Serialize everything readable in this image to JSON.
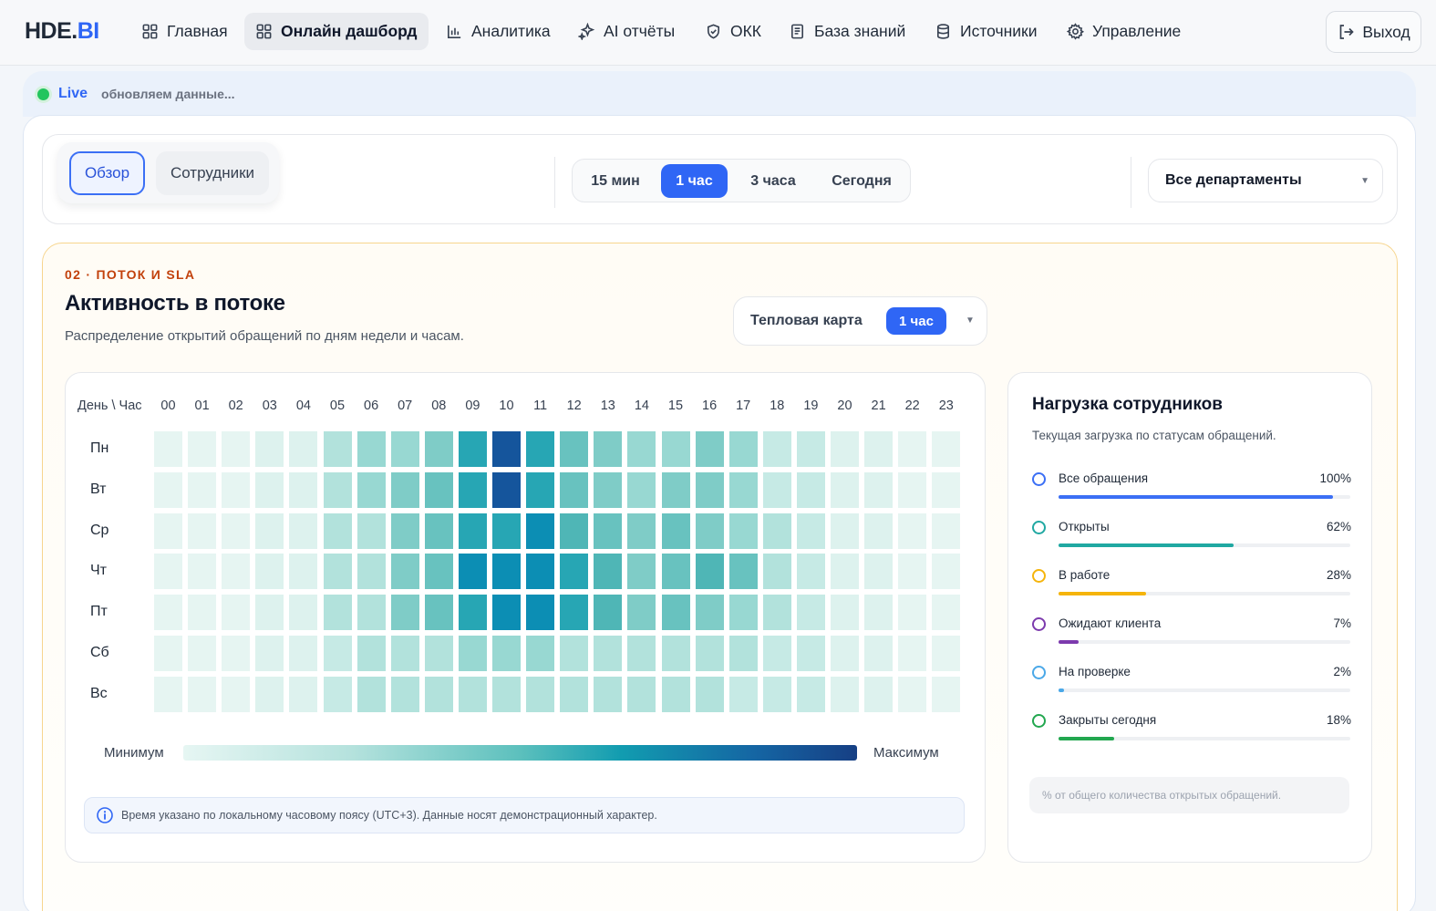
{
  "brand": {
    "logo_main": "HDE.",
    "logo_accent": "BI"
  },
  "nav": {
    "items": [
      {
        "label": "Главная",
        "icon": "grid-icon"
      },
      {
        "label": "Онлайн дашборд",
        "icon": "grid-icon",
        "active": true
      },
      {
        "label": "Аналитика",
        "icon": "bar-chart-icon"
      },
      {
        "label": "AI отчёты",
        "icon": "sparkles-icon"
      },
      {
        "label": "ОКК",
        "icon": "shield-icon"
      },
      {
        "label": "База знаний",
        "icon": "document-icon"
      },
      {
        "label": "Источники",
        "icon": "database-icon"
      },
      {
        "label": "Управление",
        "icon": "gear-icon"
      }
    ],
    "logout_label": "Выход"
  },
  "live": {
    "label": "Live",
    "status": "обновляем данные..."
  },
  "controls": {
    "views": [
      "Обзор",
      "Сотрудники"
    ],
    "active_view": "Обзор",
    "ranges": [
      "15 мин",
      "1 час",
      "3 часа",
      "Сегодня"
    ],
    "active_range": "1 час",
    "department": "Все департаменты"
  },
  "section": {
    "kicker": "02 · ПОТОК И SLA",
    "title": "Активность в потоке",
    "subtitle": "Распределение открытий обращений по дням недели и часам.",
    "mode_label": "Тепловая карта",
    "mode_chip": "1 час"
  },
  "heatmap": {
    "corner_label": "День \\ Час",
    "hours": [
      "00",
      "01",
      "02",
      "03",
      "04",
      "05",
      "06",
      "07",
      "08",
      "09",
      "10",
      "11",
      "12",
      "13",
      "14",
      "15",
      "16",
      "17",
      "18",
      "19",
      "20",
      "21",
      "22",
      "23"
    ],
    "days": [
      "Пн",
      "Вт",
      "Ср",
      "Чт",
      "Пт",
      "Сб",
      "Вс"
    ],
    "values": [
      [
        0,
        0,
        0,
        1,
        1,
        3,
        4,
        4,
        5,
        8,
        10,
        8,
        6,
        5,
        4,
        4,
        5,
        4,
        2,
        2,
        1,
        1,
        0,
        0
      ],
      [
        0,
        0,
        0,
        1,
        1,
        3,
        4,
        5,
        6,
        8,
        10,
        8,
        6,
        5,
        4,
        5,
        5,
        4,
        2,
        2,
        1,
        1,
        0,
        0
      ],
      [
        0,
        0,
        0,
        1,
        1,
        3,
        3,
        5,
        6,
        8,
        8,
        9,
        7,
        6,
        5,
        6,
        5,
        4,
        3,
        2,
        1,
        1,
        0,
        0
      ],
      [
        0,
        0,
        0,
        1,
        1,
        3,
        3,
        5,
        6,
        9,
        9,
        9,
        8,
        7,
        5,
        6,
        7,
        6,
        3,
        2,
        1,
        1,
        0,
        0
      ],
      [
        0,
        0,
        0,
        1,
        1,
        3,
        3,
        5,
        6,
        8,
        9,
        9,
        8,
        7,
        5,
        6,
        5,
        4,
        3,
        2,
        1,
        1,
        0,
        0
      ],
      [
        0,
        0,
        0,
        1,
        1,
        2,
        3,
        3,
        3,
        4,
        4,
        4,
        3,
        3,
        3,
        3,
        3,
        3,
        2,
        2,
        1,
        1,
        0,
        0
      ],
      [
        0,
        0,
        0,
        1,
        1,
        2,
        3,
        3,
        3,
        3,
        3,
        3,
        3,
        3,
        3,
        3,
        3,
        2,
        2,
        2,
        1,
        1,
        0,
        0
      ]
    ],
    "scale_colors": [
      "#e6f5f2",
      "#ddf2ee",
      "#c6eae5",
      "#b2e2dc",
      "#98d8d2",
      "#7fccc7",
      "#68c2bf",
      "#4fb6b6",
      "#27a6b4",
      "#0c8eb4",
      "#15559c"
    ],
    "legend_min": "Минимум",
    "legend_max": "Максимум",
    "note": "Время указано по локальному часовому поясу (UTC+3). Данные носят демонстрационный характер."
  },
  "load": {
    "title": "Нагрузка сотрудников",
    "subtitle": "Текущая загрузка по статусам обращений.",
    "rows": [
      {
        "label": "Все обращения",
        "pct_label": "100%",
        "fill": 0.94,
        "color": "#3b6ff5"
      },
      {
        "label": "Открыты",
        "pct_label": "62%",
        "fill": 0.6,
        "color": "#20a8a2"
      },
      {
        "label": "В работе",
        "pct_label": "28%",
        "fill": 0.3,
        "color": "#f5b40b"
      },
      {
        "label": "Ожидают клиента",
        "pct_label": "7%",
        "fill": 0.07,
        "color": "#7c3aad"
      },
      {
        "label": "На проверке",
        "pct_label": "2%",
        "fill": 0.02,
        "color": "#4aa8e8"
      },
      {
        "label": "Закрыты сегодня",
        "pct_label": "18%",
        "fill": 0.19,
        "color": "#22a74f"
      }
    ],
    "footnote": "% от общего количества открытых обращений."
  }
}
